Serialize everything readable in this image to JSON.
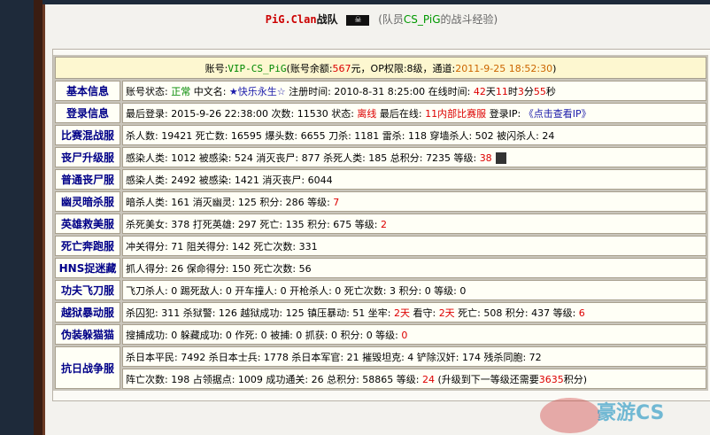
{
  "title": {
    "tag": "PiG.Clan",
    "team": "战队",
    "prefix": "(队员",
    "player": "CS_PiG",
    "suffix": "的战斗经验)"
  },
  "header": {
    "account_label": "账号:",
    "account": "VIP-CS_PiG",
    "balance_label": "(账号余额:",
    "balance": "567",
    "balance_unit": "元，OP权限:",
    "op": "8级，通道:",
    "time": "2011-9-25 18:52:30",
    "close": ")"
  },
  "rows": [
    {
      "cat": "基本信息",
      "parts": [
        [
          "账号状态: ",
          ""
        ],
        [
          "正常",
          "g"
        ],
        [
          " 中文名: ",
          ""
        ],
        [
          "★快乐永生☆",
          "b"
        ],
        [
          " 注册时间: 2010-8-31 8:25:00 在线时间: ",
          ""
        ],
        [
          "42",
          "r"
        ],
        [
          "天",
          ""
        ],
        [
          "11",
          "r"
        ],
        [
          "时",
          ""
        ],
        [
          "3",
          "r"
        ],
        [
          "分",
          ""
        ],
        [
          "55",
          "r"
        ],
        [
          "秒",
          ""
        ]
      ]
    },
    {
      "cat": "登录信息",
      "parts": [
        [
          "最后登录: 2015-9-26 22:38:00 次数: 11530 状态: ",
          ""
        ],
        [
          "离线",
          "r"
        ],
        [
          " 最后在线: ",
          ""
        ],
        [
          "11内部比赛服",
          "r"
        ],
        [
          " 登录IP: ",
          ""
        ],
        [
          "《点击查看IP》",
          "b"
        ]
      ]
    },
    {
      "cat": "比赛混战服",
      "parts": [
        [
          "杀人数: 19421 死亡数: 16595 爆头数: 6655 刀杀: 1181 雷杀: 118 穿墙杀人: 502 被闪杀人: 24",
          ""
        ]
      ]
    },
    {
      "cat": "丧尸升级服",
      "parts": [
        [
          "感染人类: 1012 被感染: 524 消灭丧尸: 877 杀死人类: 185 总积分: 7235 等级: ",
          ""
        ],
        [
          "38",
          "r"
        ]
      ],
      "avatar": true
    },
    {
      "cat": "普通丧尸服",
      "parts": [
        [
          "感染人类: 2492 被感染: 1421 消灭丧尸: 6044",
          ""
        ]
      ]
    },
    {
      "cat": "幽灵暗杀服",
      "parts": [
        [
          "暗杀人类: 161 消灭幽灵: 125 积分: 286 等级: ",
          ""
        ],
        [
          "7",
          "r"
        ]
      ]
    },
    {
      "cat": "英雄救美服",
      "parts": [
        [
          "杀死美女: 378 打死英雄: 297 死亡: 135 积分: 675 等级: ",
          ""
        ],
        [
          "2",
          "r"
        ]
      ]
    },
    {
      "cat": "死亡奔跑服",
      "parts": [
        [
          "冲关得分: 71 阻关得分: 142 死亡次数: 331",
          ""
        ]
      ]
    },
    {
      "cat": "HNS捉迷藏",
      "parts": [
        [
          "抓人得分: 26 保命得分: 150 死亡次数: 56",
          ""
        ]
      ]
    },
    {
      "cat": "功夫飞刀服",
      "parts": [
        [
          "飞刀杀人: 0 踢死敌人: 0 开车撞人: 0 开枪杀人: 0 死亡次数: 3 积分: 0 等级: 0",
          ""
        ]
      ]
    },
    {
      "cat": "越狱暴动服",
      "parts": [
        [
          "杀囚犯: 311 杀狱警: 126 越狱成功: 125 镇压暴动: 51 坐牢: ",
          ""
        ],
        [
          "2天",
          "r"
        ],
        [
          " 看守: ",
          ""
        ],
        [
          "2天",
          "r"
        ],
        [
          " 死亡: 508 积分: 437 等级: ",
          ""
        ],
        [
          "6",
          "r"
        ]
      ]
    },
    {
      "cat": "伪装躲猫猫",
      "parts": [
        [
          "搜捕成功: 0 躲藏成功: 0 作死: 0 被捕: 0 抓获: 0 积分: 0 等级: ",
          ""
        ],
        [
          "0",
          "r"
        ]
      ]
    }
  ],
  "war": {
    "cat": "抗日战争服",
    "line1": "杀日本平民: 7492 杀日本士兵: 1778 杀日本军官: 21 摧毁坦克: 4 铲除汉奸: 174 残杀同胞: 72",
    "line2a": "阵亡次数: 198 占领据点: 1009 成功通关: 26 总积分: 58865 等级: ",
    "level": "24",
    "line2b": " (升级到下一等级还需要",
    "need": "3635",
    "line2c": "积分)"
  },
  "watermark": "豪游CS"
}
